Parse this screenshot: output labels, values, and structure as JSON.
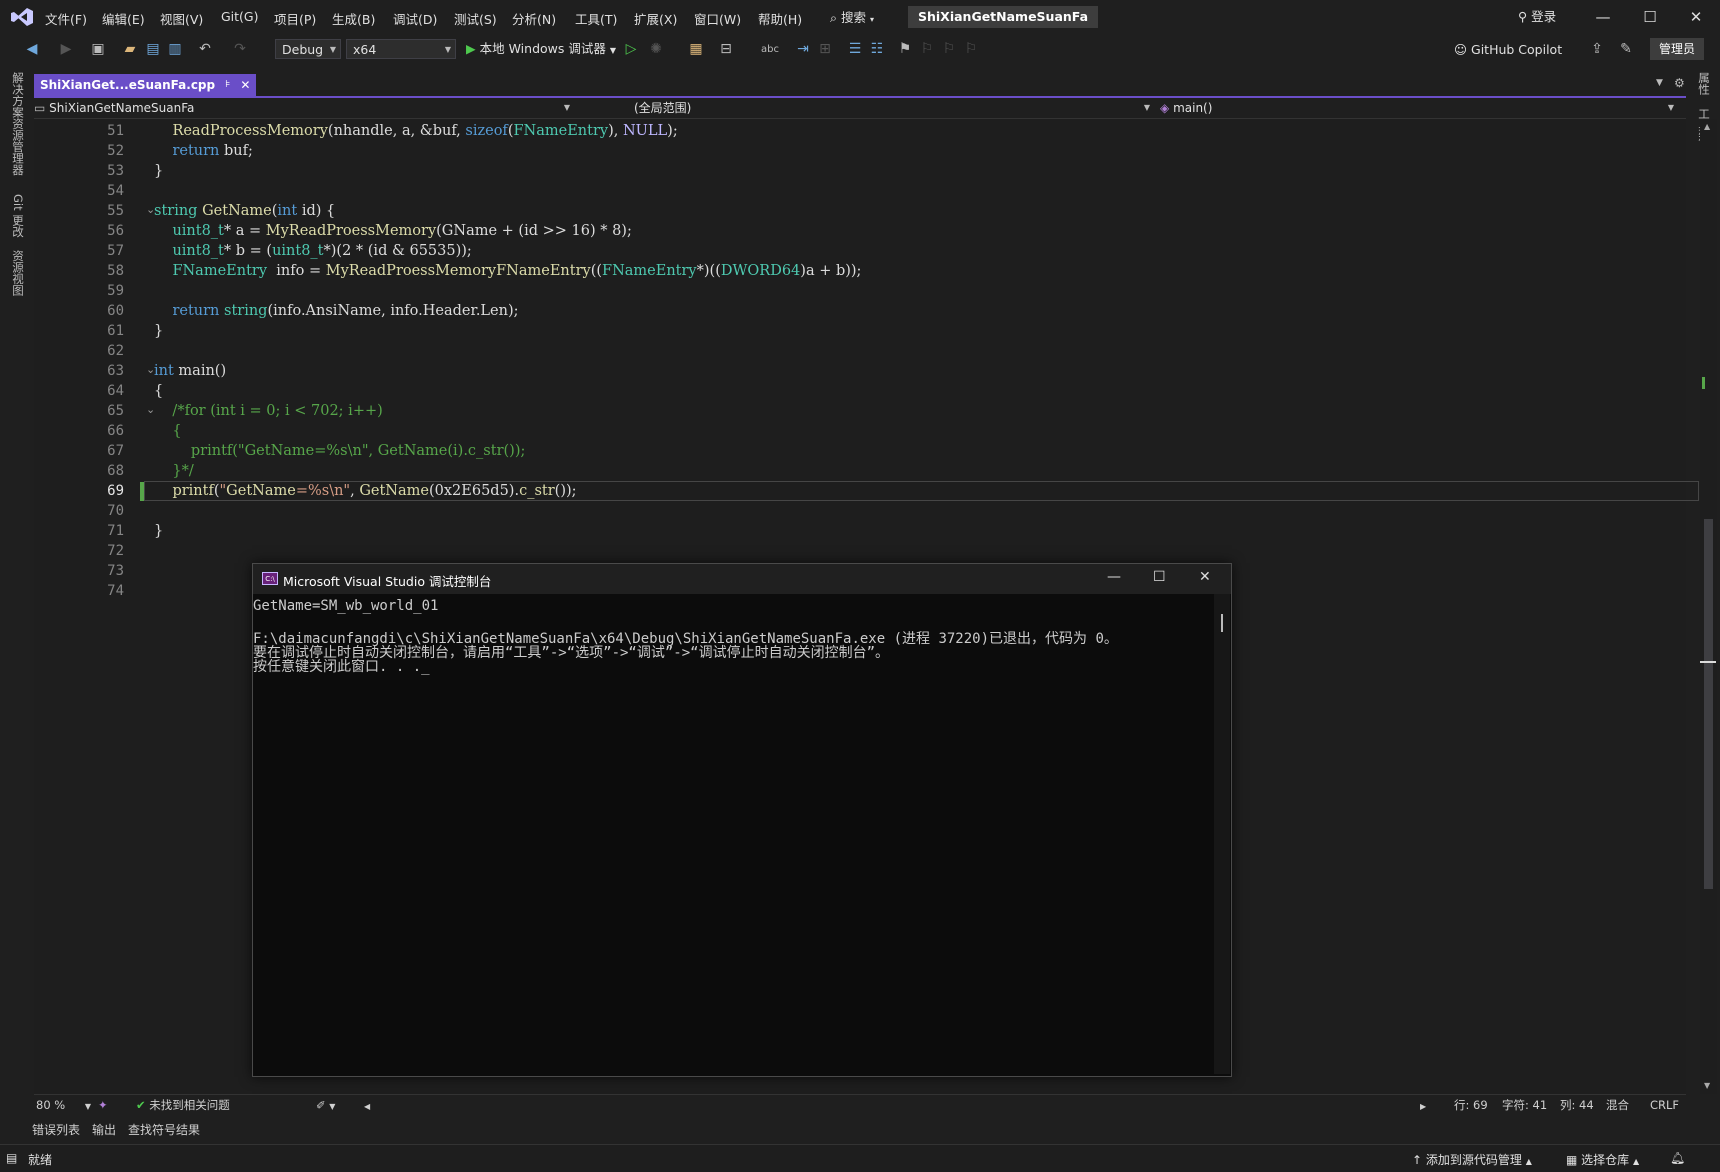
{
  "menu": [
    "文件(F)",
    "编辑(E)",
    "视图(V)",
    "Git(G)",
    "项目(P)",
    "生成(B)",
    "调试(D)",
    "测试(S)",
    "分析(N)",
    "工具(T)",
    "扩展(X)",
    "窗口(W)",
    "帮助(H)"
  ],
  "search_label": "搜索",
  "solution_name": "ShiXianGetNameSuanFa",
  "signin_label": "登录",
  "toolbar": {
    "config": "Debug",
    "platform": "x64",
    "run_label": "本地 Windows 调试器",
    "copilot_label": "GitHub Copilot",
    "admin_label": "管理员"
  },
  "left_rail": [
    "解决方案资源管理器",
    "Git 更改",
    "资源视图"
  ],
  "right_rail": [
    "属性",
    "工具箱"
  ],
  "doc_tab": {
    "title": "ShiXianGet...eSuanFa.cpp",
    "pin": "⊧",
    "close": "✕"
  },
  "nav": {
    "project": "ShiXianGetNameSuanFa",
    "scope": "(全局范围)",
    "member": "main()"
  },
  "line_numbers": [
    "51",
    "52",
    "53",
    "54",
    "55",
    "56",
    "57",
    "58",
    "59",
    "60",
    "61",
    "62",
    "63",
    "64",
    "65",
    "66",
    "67",
    "68",
    "69",
    "70",
    "71",
    "72",
    "73",
    "74"
  ],
  "code_lines": [
    "    ReadProcessMemory(nhandle, a, &buf, sizeof(FNameEntry), NULL);",
    "    return buf;",
    "}",
    "",
    "string GetName(int id) {",
    "    uint8_t* a = MyReadProessMemory(GName + (id >> 16) * 8);",
    "    uint8_t* b = (uint8_t*)(2 * (id & 65535));",
    "    FNameEntry  info = MyReadProessMemoryFNameEntry((FNameEntry*)((DWORD64)a + b));",
    "",
    "    return string(info.AnsiName, info.Header.Len);",
    "}",
    "",
    "int main()",
    "{",
    "    /*for (int i = 0; i < 702; i++)",
    "    {",
    "        printf(\"GetName=%s\\n\", GetName(i).c_str());",
    "    }*/",
    "    printf(\"GetName=%s\\n\", GetName(0x2E65d5).c_str());",
    "",
    "}",
    "",
    "",
    ""
  ],
  "console": {
    "title": "Microsoft Visual Studio 调试控制台",
    "lines": [
      "GetName=SM_wb_world_01",
      "",
      "F:\\daimacunfangdi\\c\\ShiXianGetNameSuanFa\\x64\\Debug\\ShiXianGetNameSuanFa.exe (进程 37220)已退出，代码为 0。",
      "要在调试停止时自动关闭控制台，请启用“工具”->“选项”->“调试”->“调试停止时自动关闭控制台”。",
      "按任意键关闭此窗口. . ._"
    ]
  },
  "editor_status": {
    "zoom": "80 %",
    "issues": "未找到相关问题",
    "line": "行: 69",
    "char": "字符: 41",
    "col": "列: 44",
    "mixed": "混合",
    "eol": "CRLF"
  },
  "bottom_tabs": [
    "错误列表",
    "输出",
    "查找符号结果"
  ],
  "status_bar": {
    "ready": "就绪",
    "add_source": "添加到源代码管理",
    "select_repo": "选择仓库"
  },
  "colors": {
    "accent": "#6a4ec8",
    "keyword": "#569cd6",
    "type": "#4ec9b0",
    "string": "#d69d85",
    "comment": "#57a64a"
  }
}
